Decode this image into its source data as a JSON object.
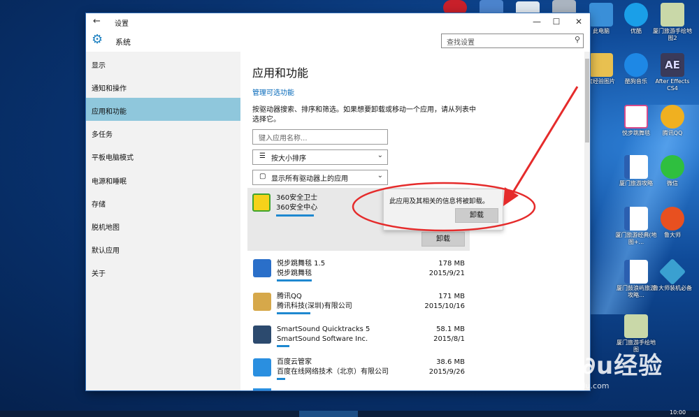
{
  "window": {
    "title": "设置",
    "back_glyph": "←",
    "min_glyph": "—",
    "max_glyph": "☐",
    "close_glyph": "✕"
  },
  "header": {
    "section": "系统",
    "search_placeholder": "查找设置"
  },
  "sidebar": {
    "items": [
      {
        "label": "显示"
      },
      {
        "label": "通知和操作"
      },
      {
        "label": "应用和功能",
        "selected": true
      },
      {
        "label": "多任务"
      },
      {
        "label": "平板电脑模式"
      },
      {
        "label": "电源和睡眠"
      },
      {
        "label": "存储"
      },
      {
        "label": "脱机地图"
      },
      {
        "label": "默认应用"
      },
      {
        "label": "关于"
      }
    ]
  },
  "main": {
    "title": "应用和功能",
    "manage_link": "管理可选功能",
    "description": "按驱动器搜索、排序和筛选。如果想要卸载或移动一个应用，请从列表中选择它。",
    "search_placeholder": "键入应用名称...",
    "sort_value": "按大小排序",
    "filter_value": "显示所有驱动器上的应用",
    "uninstall_label": "卸载",
    "popup": {
      "message": "此应用及其相关的信息将被卸载。",
      "button": "卸载"
    },
    "apps": [
      {
        "name": "360安全卫士",
        "publisher": "360安全中心",
        "size": "",
        "date": "",
        "icon_color": "#3fa52e",
        "selected": true
      },
      {
        "name": "悦步跳舞毯 1.5",
        "publisher": "悦步跳舞毯",
        "size": "178 MB",
        "date": "2015/9/21",
        "icon_color": "#2a6fc9"
      },
      {
        "name": "腾讯QQ",
        "publisher": "腾讯科技(深圳)有限公司",
        "size": "171 MB",
        "date": "2015/10/16",
        "icon_color": "#d6a84a"
      },
      {
        "name": "SmartSound Quicktracks 5",
        "publisher": "SmartSound Software Inc.",
        "size": "58.1 MB",
        "date": "2015/8/1",
        "icon_color": "#2c4a6e"
      },
      {
        "name": "百度云管家",
        "publisher": "百度在线网络技术（北京）有限公司",
        "size": "38.6 MB",
        "date": "2015/9/26",
        "icon_color": "#2a8fe0"
      }
    ]
  },
  "desktop": {
    "icons": [
      {
        "label": "此电脑",
        "color": "#3a8fd8"
      },
      {
        "label": "优酷",
        "color": "#1a9fe8"
      },
      {
        "label": "厦门旅游手绘地图2",
        "color": "#c9d8a8"
      },
      {
        "label": "度经验图片",
        "color": "#e8c050"
      },
      {
        "label": "酷狗音乐",
        "color": "#1e88e5"
      },
      {
        "label": "After Effects CS4",
        "color": "#3a3a5a"
      },
      {
        "label": "悦步跳舞毯",
        "color": "#d84a8a"
      },
      {
        "label": "腾讯QQ",
        "color": "#f0b020"
      },
      {
        "label": "厦门旅游攻略",
        "color": "#2b5fb0"
      },
      {
        "label": "微信",
        "color": "#2fbf3f"
      },
      {
        "label": "厦门旅游经典(地图+...",
        "color": "#2b5fb0"
      },
      {
        "label": "鲁大师",
        "color": "#e85020"
      },
      {
        "label": "厦门鼓浪屿旅游攻略...",
        "color": "#2b5fb0"
      },
      {
        "label": "鲁大师装机必备",
        "color": "#3aa0d0"
      },
      {
        "label": "厦门旅游手绘地图",
        "color": "#c9d8a8"
      }
    ],
    "after_effects_text": "AE"
  },
  "watermark": {
    "brand": "Bai∂u经验",
    "url": "jingyan.baidu.com"
  },
  "taskbar": {
    "clock": "10:00"
  },
  "colors": {
    "accent": "#0066b8",
    "selected_nav": "#8fc7dc",
    "annotation": "#e52b2b"
  }
}
